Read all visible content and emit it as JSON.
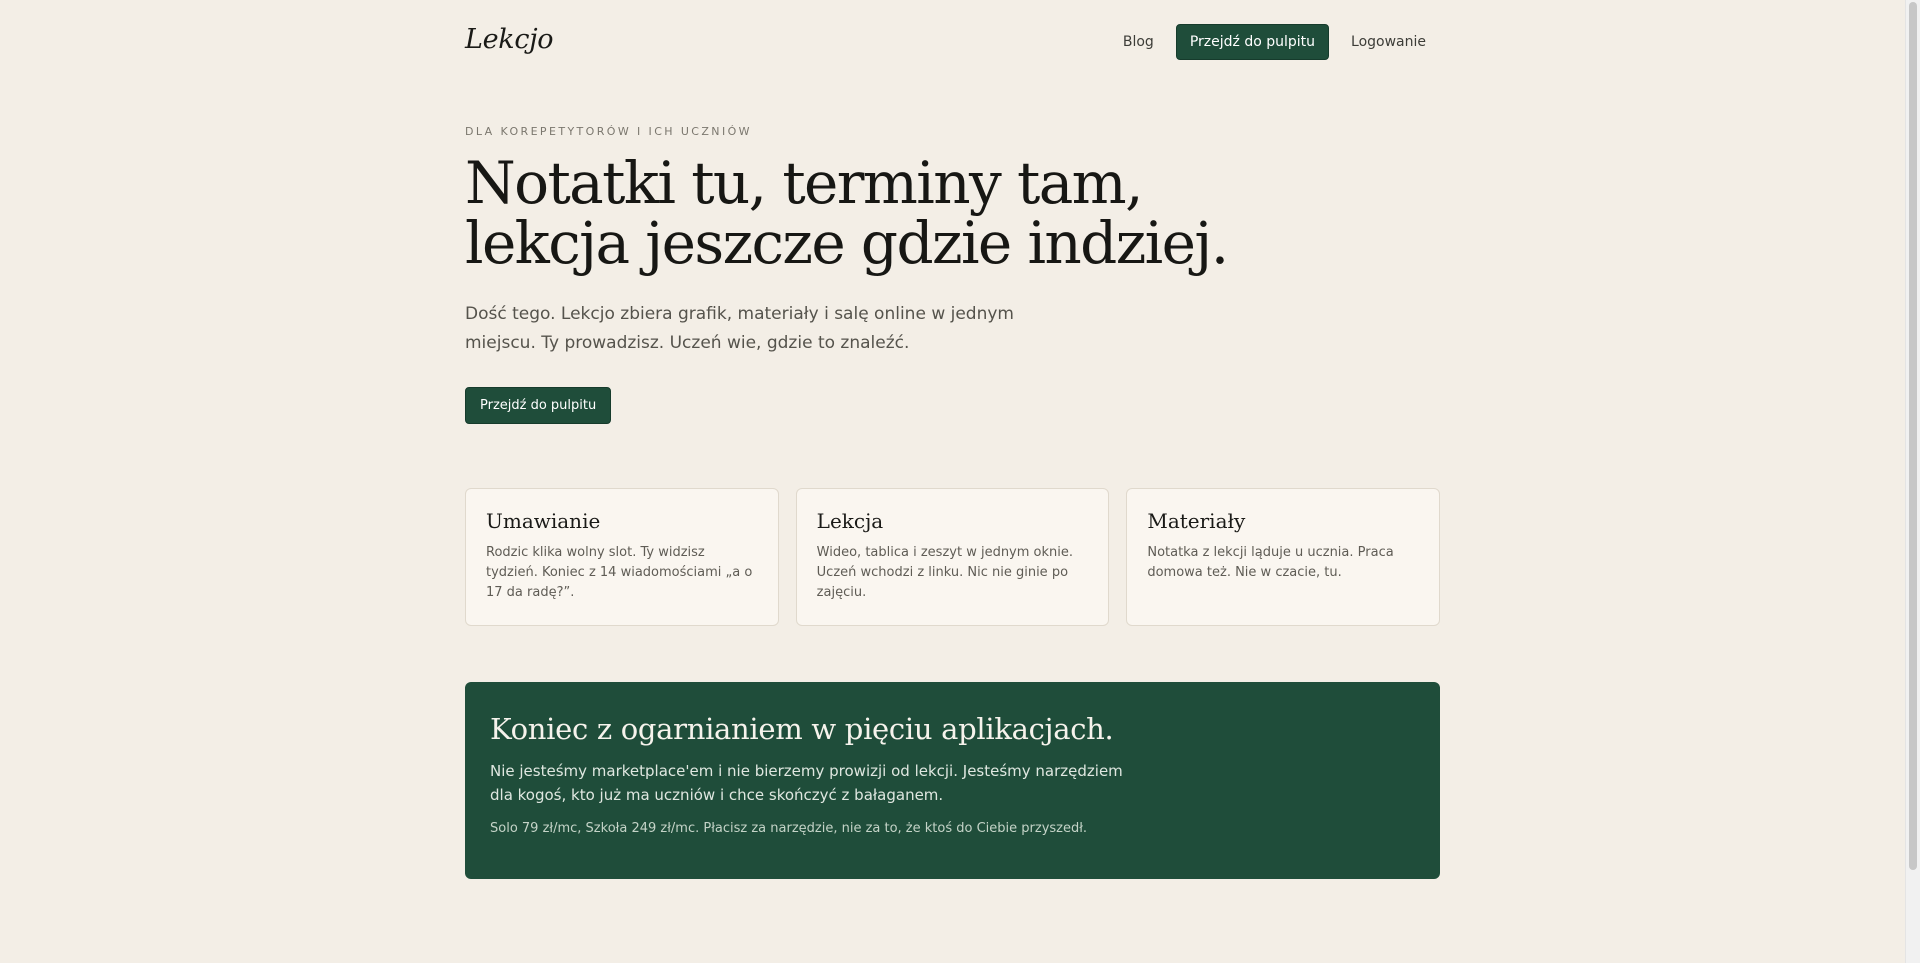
{
  "header": {
    "logo": "Lekcjo",
    "nav": {
      "blog": "Blog",
      "dashboard_button": "Przejdź do pulpitu",
      "login": "Logowanie"
    }
  },
  "hero": {
    "eyebrow": "DLA KOREPETYTORÓW I ICH UCZNIÓW",
    "headline_line1": "Notatki tu, terminy tam,",
    "headline_line2": "lekcja jeszcze gdzie indziej.",
    "lead": "Dość tego. Lekcjo zbiera grafik, materiały i salę online w jednym miejscu. Ty prowadzisz. Uczeń wie, gdzie to znaleźć.",
    "cta_button": "Przejdź do pulpitu"
  },
  "features": [
    {
      "title": "Umawianie",
      "text": "Rodzic klika wolny slot. Ty widzisz tydzień. Koniec z 14 wiadomościami „a o 17 da radę?”."
    },
    {
      "title": "Lekcja",
      "text": "Wideo, tablica i zeszyt w jednym oknie. Uczeń wchodzi z linku. Nic nie ginie po zajęciu."
    },
    {
      "title": "Materiały",
      "text": "Notatka z lekcji ląduje u ucznia. Praca domowa też. Nie w czacie, tu."
    }
  ],
  "panel": {
    "title": "Koniec z ogarnianiem w pięciu aplikacjach.",
    "text": "Nie jesteśmy marketplace'em i nie bierzemy prowizji od lekcji. Jesteśmy narzędziem dla kogoś, kto już ma uczniów i chce skończyć z bałaganem.",
    "note": "Solo 79 zł/mc, Szkoła 249 zł/mc. Płacisz za narzędzie, nie za to, że ktoś do Ciebie przyszedł."
  },
  "colors": {
    "background": "#f3eee6",
    "accent": "#1f4d3a",
    "card": "#faf6f0"
  }
}
